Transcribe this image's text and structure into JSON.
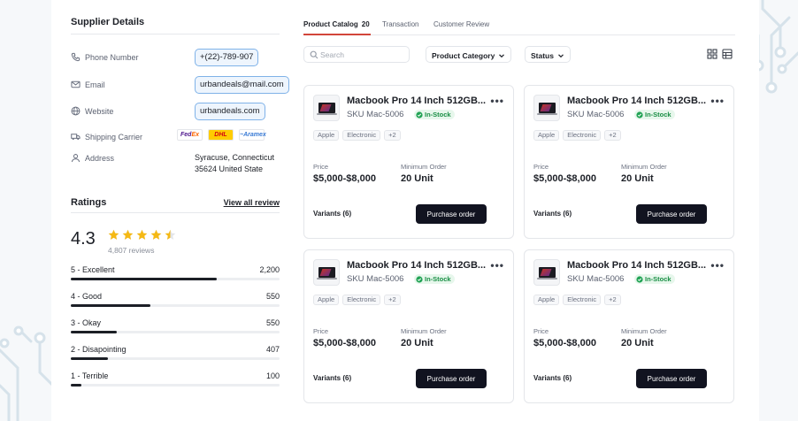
{
  "supplier": {
    "title": "Supplier Details",
    "phone": {
      "label": "Phone Number",
      "value": "+(22)-789-907",
      "icon": "phone-icon"
    },
    "email": {
      "label": "Email",
      "value": "urbandeals@mail.com",
      "icon": "mail-icon"
    },
    "website": {
      "label": "Website",
      "value": "urbandeals.com",
      "icon": "globe-icon"
    },
    "shipping": {
      "label": "Shipping Carrier",
      "icon": "truck-icon",
      "carriers": [
        "FedEx",
        "DHL",
        "Aramex"
      ]
    },
    "address": {
      "label": "Address",
      "line1": "Syracuse, Connecticut",
      "line2": "35624 United State",
      "icon": "user-pin-icon"
    }
  },
  "ratings": {
    "title": "Ratings",
    "view_all": "View all review",
    "average": "4.3",
    "stars_filled": 4.5,
    "reviews": "4,807 reviews",
    "breakdown": [
      {
        "label": "5 - Excellent",
        "count": "2,200",
        "fraction": 0.7
      },
      {
        "label": "4 - Good",
        "count": "550",
        "fraction": 0.38
      },
      {
        "label": "3 - Okay",
        "count": "550",
        "fraction": 0.22
      },
      {
        "label": "2 - Disapointing",
        "count": "407",
        "fraction": 0.18
      },
      {
        "label": "1 - Terrible",
        "count": "100",
        "fraction": 0.05
      }
    ]
  },
  "tabs": [
    {
      "label": "Product Catalog",
      "count": "20",
      "active": true
    },
    {
      "label": "Transaction"
    },
    {
      "label": "Customer Review"
    }
  ],
  "toolbar": {
    "search_placeholder": "Search",
    "category_label": "Product Category",
    "status_label": "Status"
  },
  "products": [
    {
      "title": "Macbook Pro 14 Inch 512GB...",
      "sku": "SKU Mac-5006",
      "stock": "In-Stock",
      "tags": [
        "Apple",
        "Electronic",
        "+2"
      ],
      "price_label": "Price",
      "price": "$5,000-$8,000",
      "min_label": "Minimum Order",
      "min": "20 Unit",
      "variants": "Variants (6)",
      "button": "Purchase order"
    },
    {
      "title": "Macbook Pro 14 Inch 512GB...",
      "sku": "SKU Mac-5006",
      "stock": "In-Stock",
      "tags": [
        "Apple",
        "Electronic",
        "+2"
      ],
      "price_label": "Price",
      "price": "$5,000-$8,000",
      "min_label": "Minimum Order",
      "min": "20 Unit",
      "variants": "Variants (6)",
      "button": "Purchase order"
    },
    {
      "title": "Macbook Pro 14 Inch 512GB...",
      "sku": "SKU Mac-5006",
      "stock": "In-Stock",
      "tags": [
        "Apple",
        "Electronic",
        "+2"
      ],
      "price_label": "Price",
      "price": "$5,000-$8,000",
      "min_label": "Minimum Order",
      "min": "20 Unit",
      "variants": "Variants (6)",
      "button": "Purchase order"
    },
    {
      "title": "Macbook Pro 14 Inch 512GB...",
      "sku": "SKU Mac-5006",
      "stock": "In-Stock",
      "tags": [
        "Apple",
        "Electronic",
        "+2"
      ],
      "price_label": "Price",
      "price": "$5,000-$8,000",
      "min_label": "Minimum Order",
      "min": "20 Unit",
      "variants": "Variants (6)",
      "button": "Purchase order"
    }
  ],
  "colors": {
    "accent_tab": "#d2453a",
    "chip_border": "#7fb2e8",
    "star": "#f5b915",
    "in_stock": "#22a355",
    "button": "#111320"
  }
}
